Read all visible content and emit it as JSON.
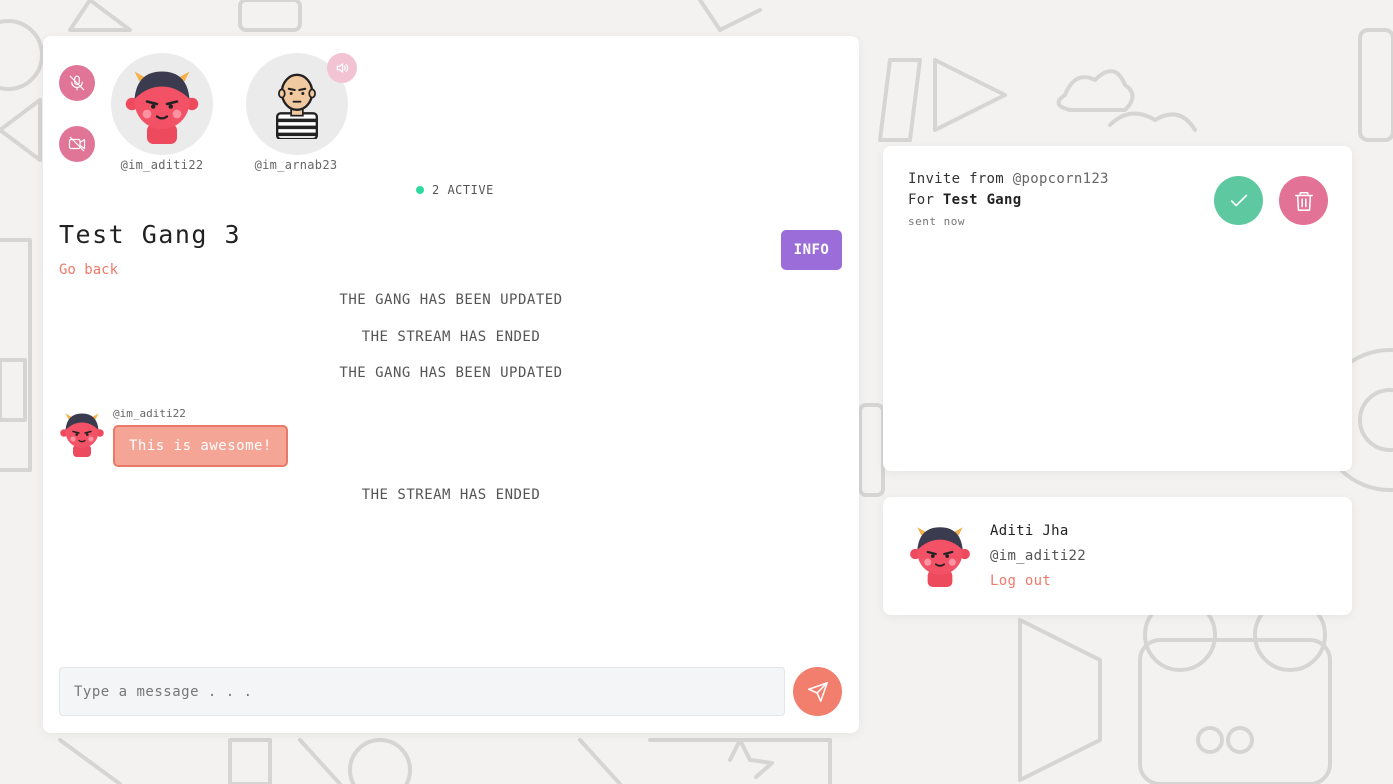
{
  "call": {
    "members": [
      {
        "handle": "@im_aditi22",
        "avatar": "devil-avatar"
      },
      {
        "handle": "@im_arnab23",
        "avatar": "prisoner-avatar"
      }
    ],
    "active_count_label": "2 ACTIVE",
    "status_color": "#2ed9a0"
  },
  "chat": {
    "title": "Test Gang 3",
    "go_back": "Go back",
    "info_label": "INFO",
    "messages": [
      {
        "type": "system",
        "text": "THE GANG HAS BEEN UPDATED"
      },
      {
        "type": "system",
        "text": "THE STREAM HAS ENDED"
      },
      {
        "type": "system",
        "text": "THE GANG HAS BEEN UPDATED"
      },
      {
        "type": "user",
        "handle": "@im_aditi22",
        "text": "This is awesome!"
      },
      {
        "type": "system",
        "text": "THE STREAM HAS ENDED"
      }
    ],
    "input_placeholder": "Type a message . . ."
  },
  "invite": {
    "prefix": "Invite from",
    "from_user": "@popcorn123",
    "for_prefix": "For",
    "gang_name": "Test Gang",
    "time": "sent now"
  },
  "profile": {
    "name": "Aditi Jha",
    "handle": "@im_aditi22",
    "logout_label": "Log out"
  },
  "colors": {
    "accent_coral": "#ee7a6a",
    "accent_pink": "#e07598",
    "info_purple": "#9b6dd8",
    "accept_green": "#5ec9a0"
  }
}
